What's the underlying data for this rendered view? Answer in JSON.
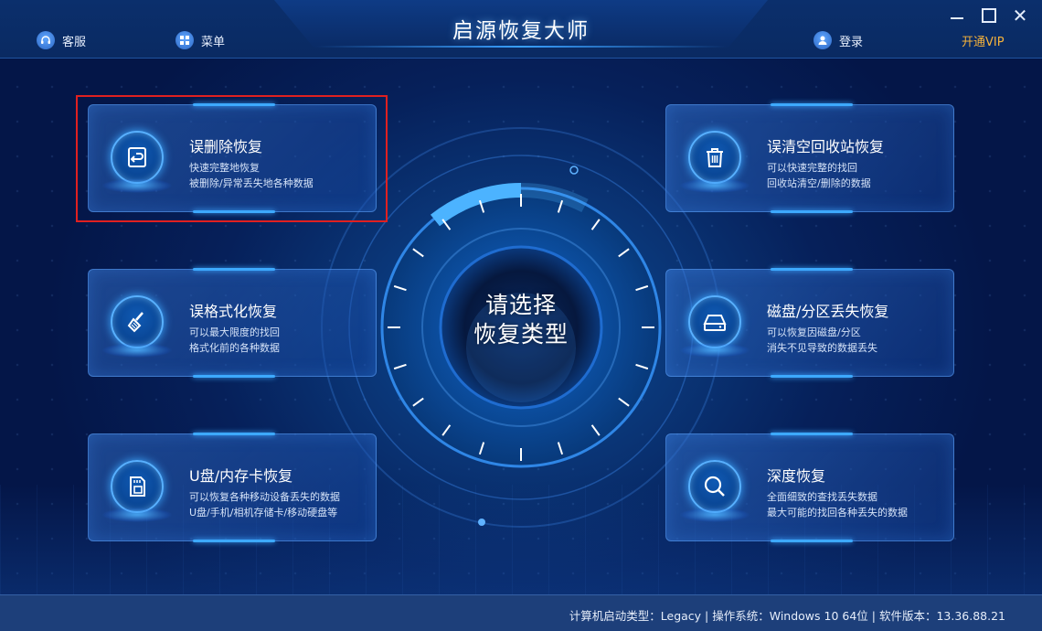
{
  "app": {
    "title": "启源恢复大师"
  },
  "header": {
    "service_label": "客服",
    "menu_label": "菜单",
    "login_label": "登录",
    "vip_label": "开通VIP"
  },
  "center": {
    "line1": "请选择",
    "line2": "恢复类型"
  },
  "cards": [
    {
      "title": "误删除恢复",
      "desc1": "快速完整地恢复",
      "desc2": "被删除/异常丢失地各种数据",
      "icon": "restore-icon"
    },
    {
      "title": "误格式化恢复",
      "desc1": "可以最大限度的找回",
      "desc2": "格式化前的各种数据",
      "icon": "broom-icon"
    },
    {
      "title": "U盘/内存卡恢复",
      "desc1": "可以恢复各种移动设备丢失的数据",
      "desc2": "U盘/手机/相机存储卡/移动硬盘等",
      "icon": "sd-card-icon"
    },
    {
      "title": "误清空回收站恢复",
      "desc1": "可以快速完整的找回",
      "desc2": "回收站清空/删除的数据",
      "icon": "trash-icon"
    },
    {
      "title": "磁盘/分区丢失恢复",
      "desc1": "可以恢复因磁盘/分区",
      "desc2": "消失不见导致的数据丢失",
      "icon": "disk-icon"
    },
    {
      "title": "深度恢复",
      "desc1": "全面细致的查找丢失数据",
      "desc2": "最大可能的找回各种丢失的数据",
      "icon": "search-icon"
    }
  ],
  "status": {
    "text": "计算机启动类型：Legacy | 操作系统：Windows 10 64位 | 软件版本：13.36.88.21"
  },
  "colors": {
    "accent": "#3da9ff",
    "vip": "#f4b23c",
    "highlight": "#e02020"
  }
}
